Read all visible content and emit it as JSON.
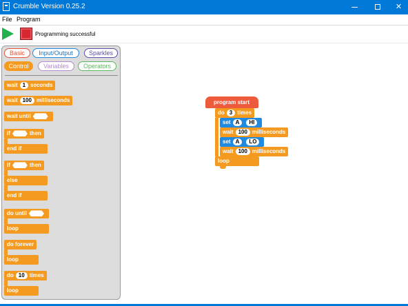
{
  "window": {
    "title": "Crumble Version 0.25.2"
  },
  "menu": {
    "file": "File",
    "program": "Program"
  },
  "toolbar": {
    "status": "Programming successful",
    "play_color": "#22b14c",
    "stop_color": "#d7262e"
  },
  "categories": {
    "basic": "Basic",
    "input_output": "Input/Output",
    "sparkles": "Sparkles",
    "control": "Control",
    "variables": "Variables",
    "operators": "Operators"
  },
  "palette": {
    "wait_seconds": {
      "word": "wait",
      "value": "1",
      "unit": "seconds"
    },
    "wait_ms": {
      "word": "wait",
      "value": "100",
      "unit": "milliseconds"
    },
    "wait_until": "wait until",
    "if_then": {
      "if": "if",
      "then": "then",
      "end": "end if"
    },
    "if_else": {
      "if": "if",
      "then": "then",
      "else": "else",
      "end": "end if"
    },
    "do_until": {
      "word": "do until",
      "end": "loop"
    },
    "do_forever": {
      "word": "do forever",
      "end": "loop"
    },
    "do_times": {
      "do": "do",
      "value": "10",
      "times": "times",
      "end": "loop"
    }
  },
  "program": {
    "start": "program start",
    "do": "do",
    "count": "3",
    "times": "times",
    "set1": {
      "word": "set",
      "pin": "A",
      "state": "HI"
    },
    "wait1": {
      "word": "wait",
      "value": "100",
      "unit": "milliseconds"
    },
    "set2": {
      "word": "set",
      "pin": "A",
      "state": "LO"
    },
    "wait2": {
      "word": "wait",
      "value": "100",
      "unit": "milliseconds"
    },
    "loop": "loop"
  }
}
